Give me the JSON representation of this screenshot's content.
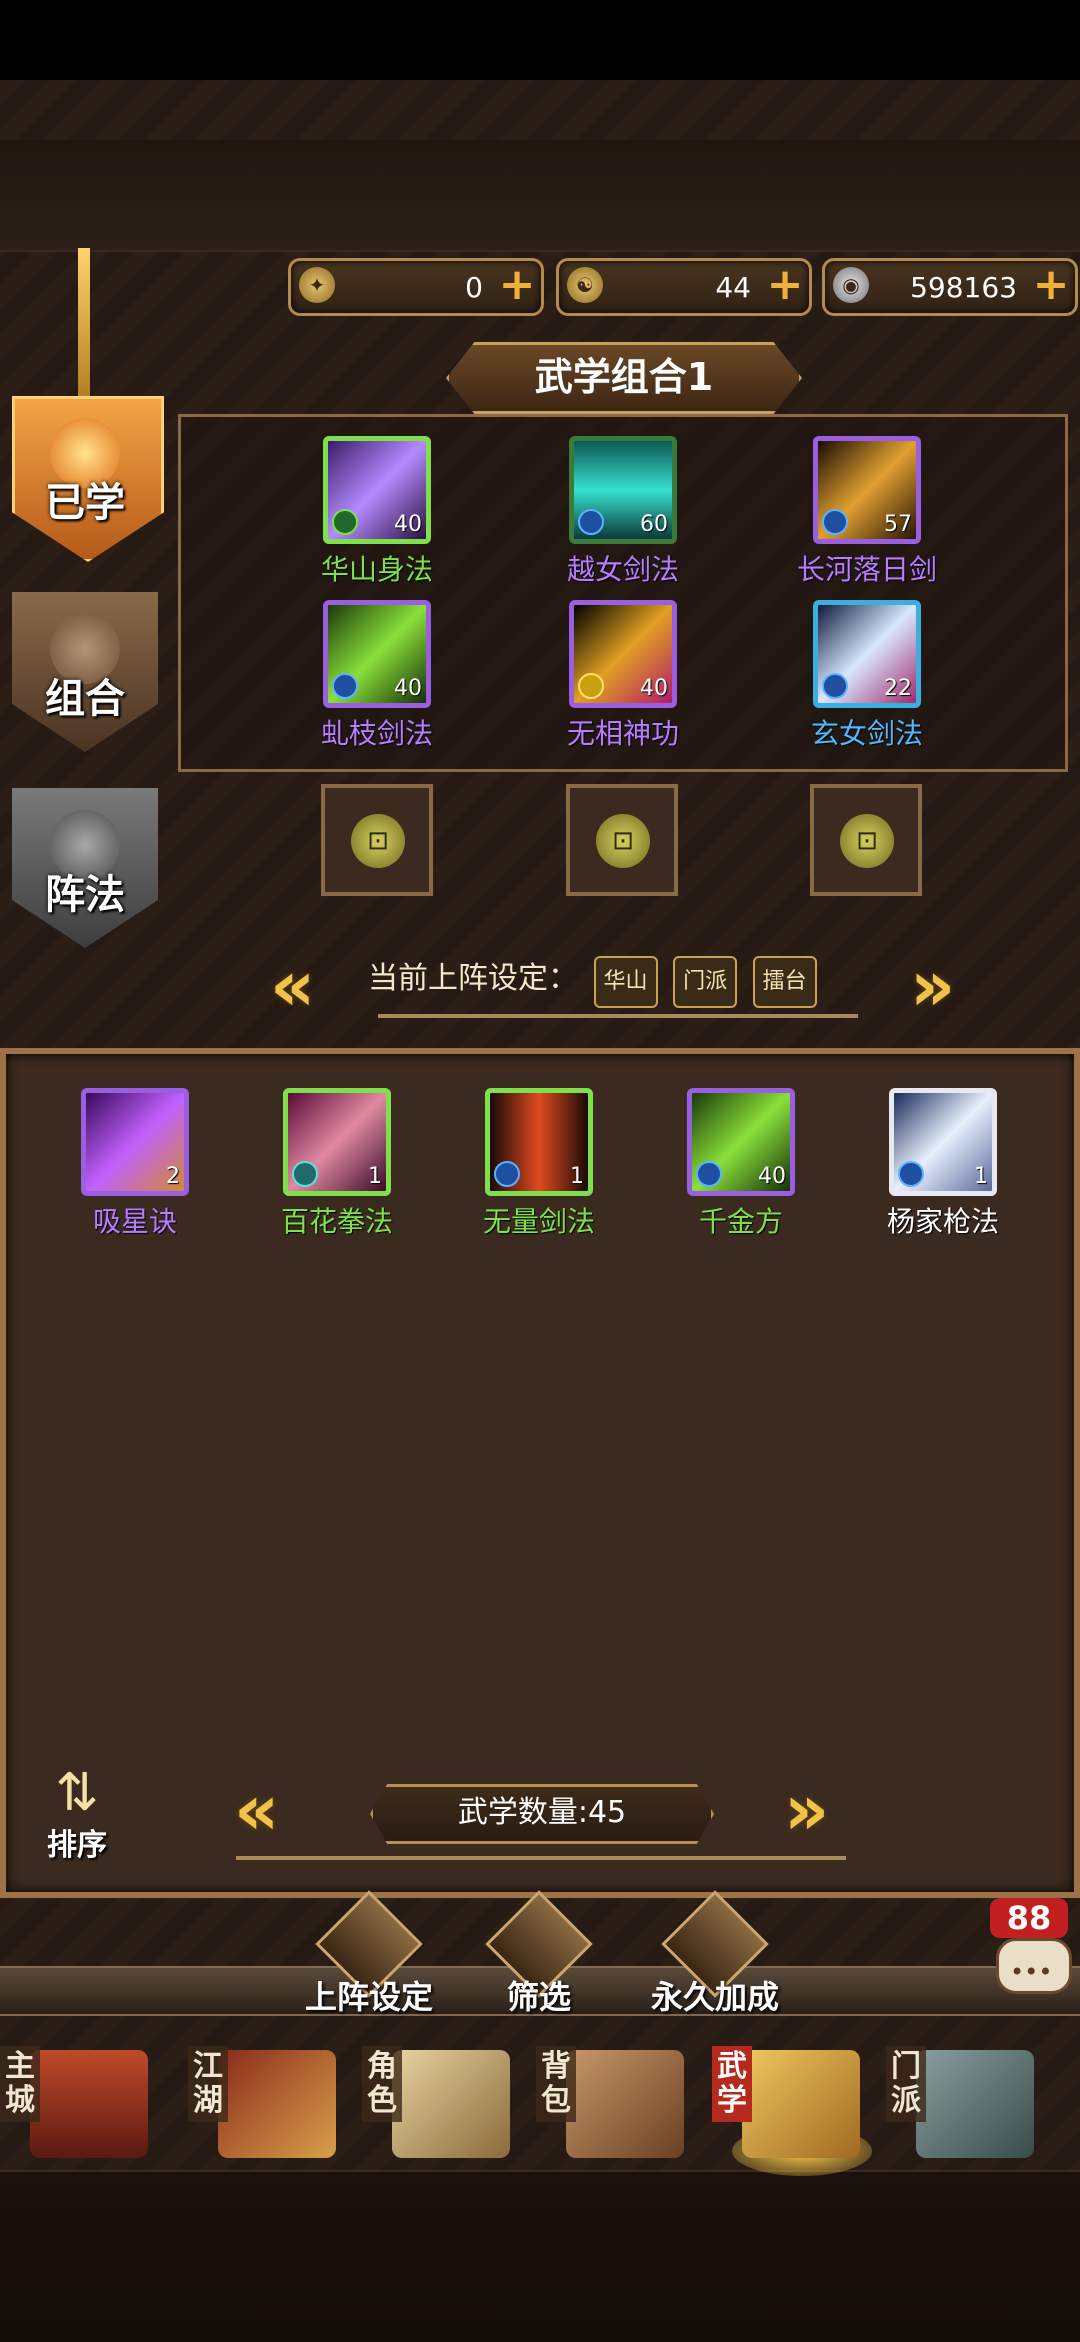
{
  "currencies": [
    {
      "icon": "token-icon",
      "value": "0"
    },
    {
      "icon": "yin-yang-icon",
      "value": "44"
    },
    {
      "icon": "silver-coin-icon",
      "value": "598163"
    }
  ],
  "side_tabs": [
    {
      "label": "已学"
    },
    {
      "label": "组合"
    },
    {
      "label": "阵法"
    }
  ],
  "combo_title": "武学组合1",
  "equipped_skills": [
    {
      "name": "华山身法",
      "level": "40",
      "color": "#b77cff"
    },
    {
      "name": "越女剑法",
      "level": "60",
      "color": "#b77cff"
    },
    {
      "name": "长河落日剑",
      "level": "57",
      "color": "#b77cff"
    },
    {
      "name": "虬枝剑法",
      "level": "40",
      "color": "#b77cff"
    },
    {
      "name": "无相神功",
      "level": "40",
      "color": "#b77cff"
    },
    {
      "name": "玄女剑法",
      "level": "22",
      "color": "#4fb8ff"
    }
  ],
  "formation": {
    "label": "当前上阵设定：",
    "tags": [
      "华山",
      "门派",
      "擂台"
    ]
  },
  "learned_skills": [
    {
      "name": "吸星诀",
      "level": "2",
      "color": "#b77cff"
    },
    {
      "name": "百花拳法",
      "level": "1",
      "color": "#7ee04a"
    },
    {
      "name": "无量剑法",
      "level": "1",
      "color": "#7ee04a"
    },
    {
      "name": "千金方",
      "level": "40",
      "color": "#7ee04a"
    },
    {
      "name": "杨家枪法",
      "level": "1",
      "color": "#ffffff"
    }
  ],
  "skill_count": "武学数量:45",
  "sort_label": "排序",
  "actions": [
    {
      "label": "上阵设定"
    },
    {
      "label": "筛选"
    },
    {
      "label": "永久加成"
    }
  ],
  "chat_badge": "88",
  "nav": [
    {
      "label": "主城",
      "active": false
    },
    {
      "label": "江湖",
      "active": false
    },
    {
      "label": "角色",
      "active": false
    },
    {
      "label": "背包",
      "active": false
    },
    {
      "label": "武学",
      "active": true
    },
    {
      "label": "门派",
      "active": false
    }
  ]
}
